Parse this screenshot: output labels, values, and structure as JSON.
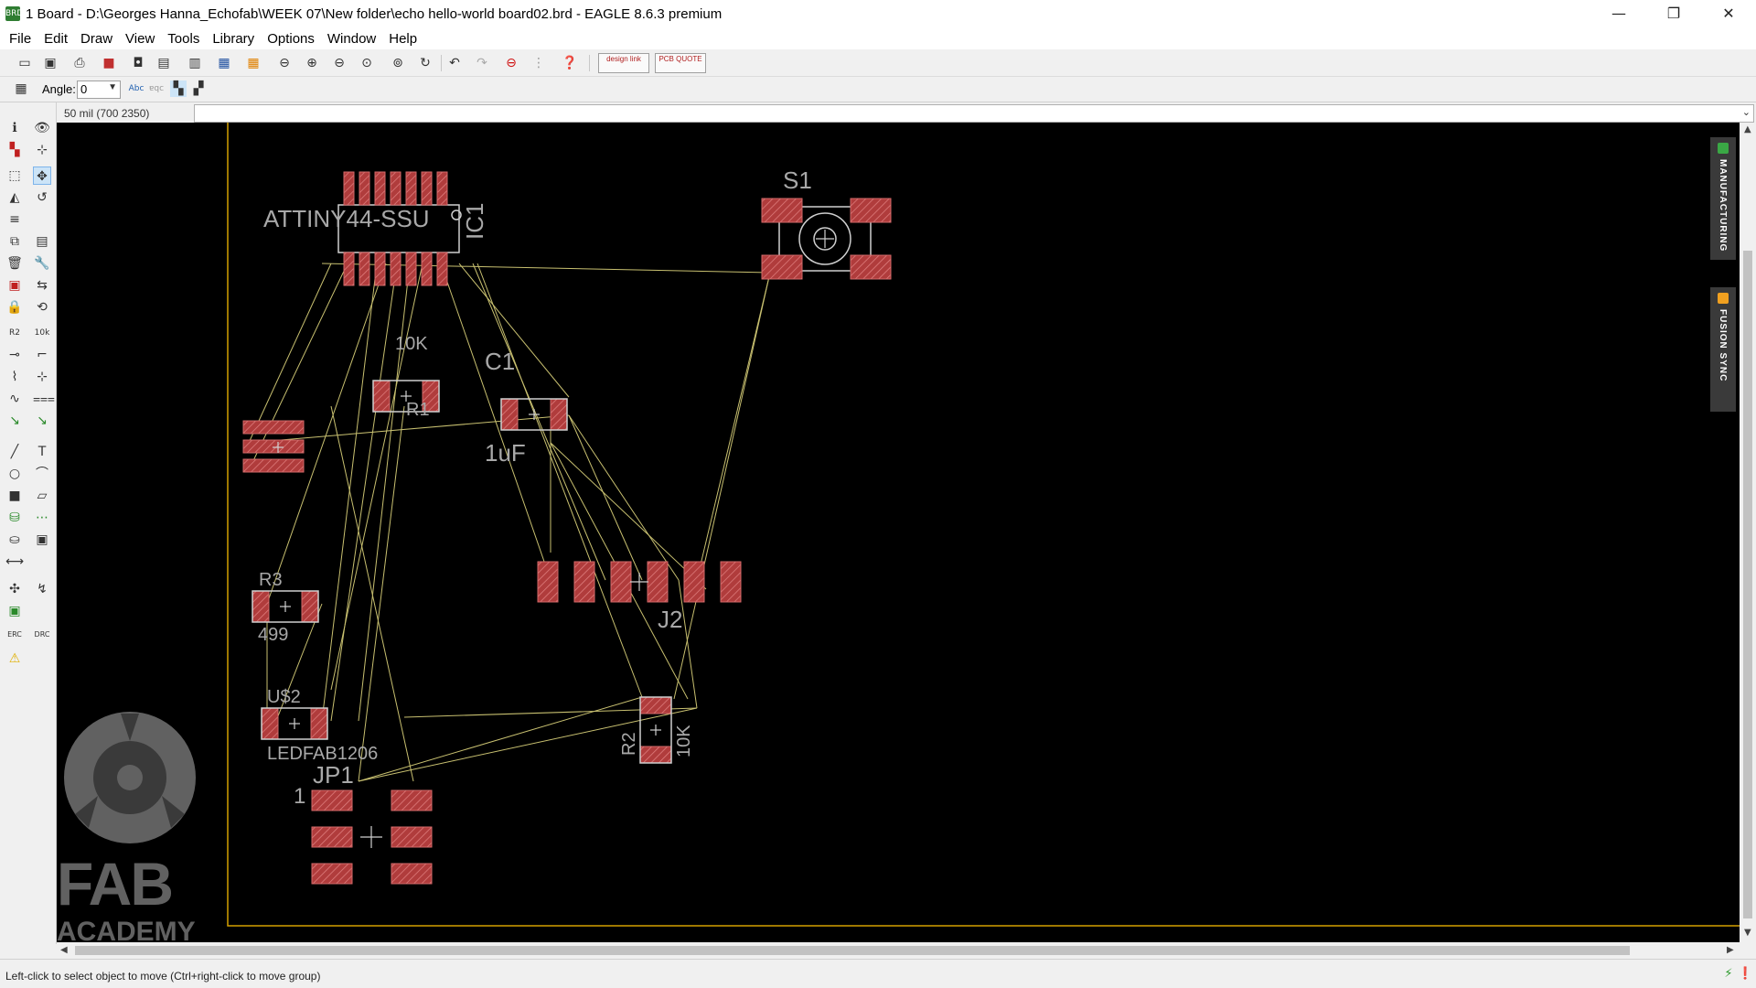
{
  "window": {
    "title": "1 Board - D:\\Georges Hanna_Echofab\\WEEK 07\\New folder\\echo hello-world board02.brd - EAGLE 8.6.3 premium",
    "icon_label": "BRD",
    "minimize": "—",
    "restore": "❐",
    "close": "✕"
  },
  "menu": {
    "items": [
      "File",
      "Edit",
      "Draw",
      "View",
      "Tools",
      "Library",
      "Options",
      "Window",
      "Help"
    ]
  },
  "toolbar": {
    "designlink": "design link",
    "pcbquote": "PCB QUOTE",
    "angle_label": "Angle:",
    "angle_value": "0"
  },
  "coords": {
    "readout": "50 mil (700 2350)",
    "command_value": ""
  },
  "side_tabs": {
    "manufacturing": "MANUFACTURING",
    "fusion_sync": "FUSION SYNC",
    "manufacturing_color": "#3aa845",
    "fusion_color": "#f0a020"
  },
  "board": {
    "ic1_name": "IC1",
    "ic1_value": "ATTINY44-SSU",
    "s1_name": "S1",
    "r1_name": "R1",
    "r1_value": "10K",
    "c1_name": "C1",
    "c1_value": "1uF",
    "r3_name": "R3",
    "r3_value": "499",
    "led_name": "U$2",
    "led_value": "LEDFAB1206",
    "jp1_name": "JP1",
    "jp1_pin1": "1",
    "j2_name": "J2",
    "r2_name": "R2",
    "r2_value": "10K",
    "pad_color": "#c04848",
    "airwire_color": "#c8c070",
    "outline_color": "#d4a000"
  },
  "watermark": {
    "line1": "FAB",
    "line2": "ACADEMY"
  },
  "status": {
    "text": "Left-click to select object to move (Ctrl+right-click to move group)"
  }
}
